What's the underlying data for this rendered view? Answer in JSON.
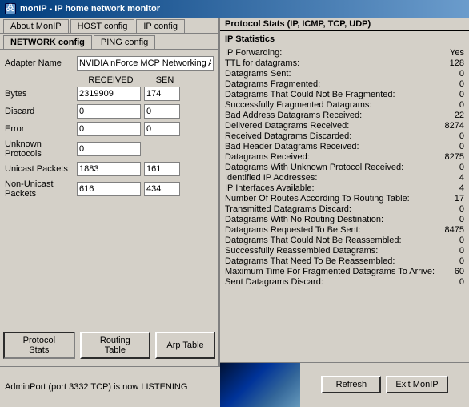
{
  "titlebar": {
    "icon": "🖧",
    "title": "monIP - IP home network monitor"
  },
  "tabs": {
    "row1": [
      "About MonIP",
      "HOST config",
      "IP config"
    ],
    "network_label": "NETWORK config",
    "row2": [
      "PING config"
    ]
  },
  "adapter": {
    "label": "Adapter Name",
    "value": "NVIDIA nForce MCP Networking Ad"
  },
  "col_headers": {
    "received": "RECEIVED",
    "sent": "SEN"
  },
  "stats": [
    {
      "label": "Bytes",
      "received": "2319909",
      "sent": "174"
    },
    {
      "label": "Discard",
      "received": "0",
      "sent": "0"
    },
    {
      "label": "Error",
      "received": "0",
      "sent": "0"
    },
    {
      "label": "Unknown Protocols",
      "received": "0",
      "sent": ""
    },
    {
      "label": "Unicast Packets",
      "received": "1883",
      "sent": "161"
    },
    {
      "label": "Non-Unicast Packets",
      "received": "616",
      "sent": "434"
    }
  ],
  "bottom_buttons": [
    {
      "id": "protocol-stats-btn",
      "label": "Protocol Stats",
      "active": true
    },
    {
      "id": "routing-table-btn",
      "label": "Routing Table",
      "active": false
    },
    {
      "id": "arp-table-btn",
      "label": "Arp Table",
      "active": false
    }
  ],
  "status": {
    "text": "AdminPort (port 3332 TCP) is now LISTENING"
  },
  "action_buttons": [
    {
      "id": "refresh-btn",
      "label": "Refresh"
    },
    {
      "id": "exit-btn",
      "label": "Exit MonIP"
    }
  ],
  "right_panel": {
    "title": "Protocol Stats (IP, ICMP, TCP, UDP)",
    "section": "IP Statistics",
    "items": [
      {
        "label": "IP Forwarding:",
        "value": "Yes"
      },
      {
        "label": "TTL for datagrams:",
        "value": "128"
      },
      {
        "label": "Datagrams Sent:",
        "value": "0"
      },
      {
        "label": "Datagrams Fragmented:",
        "value": "0"
      },
      {
        "label": "Datagrams That Could Not Be Fragmented:",
        "value": "0"
      },
      {
        "label": "Successfully Fragmented Datagrams:",
        "value": "0"
      },
      {
        "label": "Bad Address Datagrams Received:",
        "value": "22"
      },
      {
        "label": "Delivered Datagrams Received:",
        "value": "8274"
      },
      {
        "label": "Received Datagrams Discarded:",
        "value": "0"
      },
      {
        "label": "Bad Header Datagrams Received:",
        "value": "0"
      },
      {
        "label": "Datagrams Received:",
        "value": "8275"
      },
      {
        "label": "Datagrams With Unknown Protocol Received:",
        "value": "0"
      },
      {
        "label": "Identified IP Addresses:",
        "value": "4"
      },
      {
        "label": "IP Interfaces Available:",
        "value": "4"
      },
      {
        "label": "Number Of Routes According To Routing Table:",
        "value": "17"
      },
      {
        "label": "Transmitted Datagrams Discard:",
        "value": "0"
      },
      {
        "label": "Datagrams With No Routing Destination:",
        "value": "0"
      },
      {
        "label": "Datagrams Requested To Be Sent:",
        "value": "8475"
      },
      {
        "label": "Datagrams That Could Not Be Reassembled:",
        "value": "0"
      },
      {
        "label": "Successfully Reassembled Datagrams:",
        "value": "0"
      },
      {
        "label": "Datagrams That Need To Be Reassembled:",
        "value": "0"
      },
      {
        "label": "Maximum Time For Fragmented Datagrams To Arrive:",
        "value": "60"
      },
      {
        "label": "Sent Datagrams Discard:",
        "value": "0"
      }
    ]
  }
}
